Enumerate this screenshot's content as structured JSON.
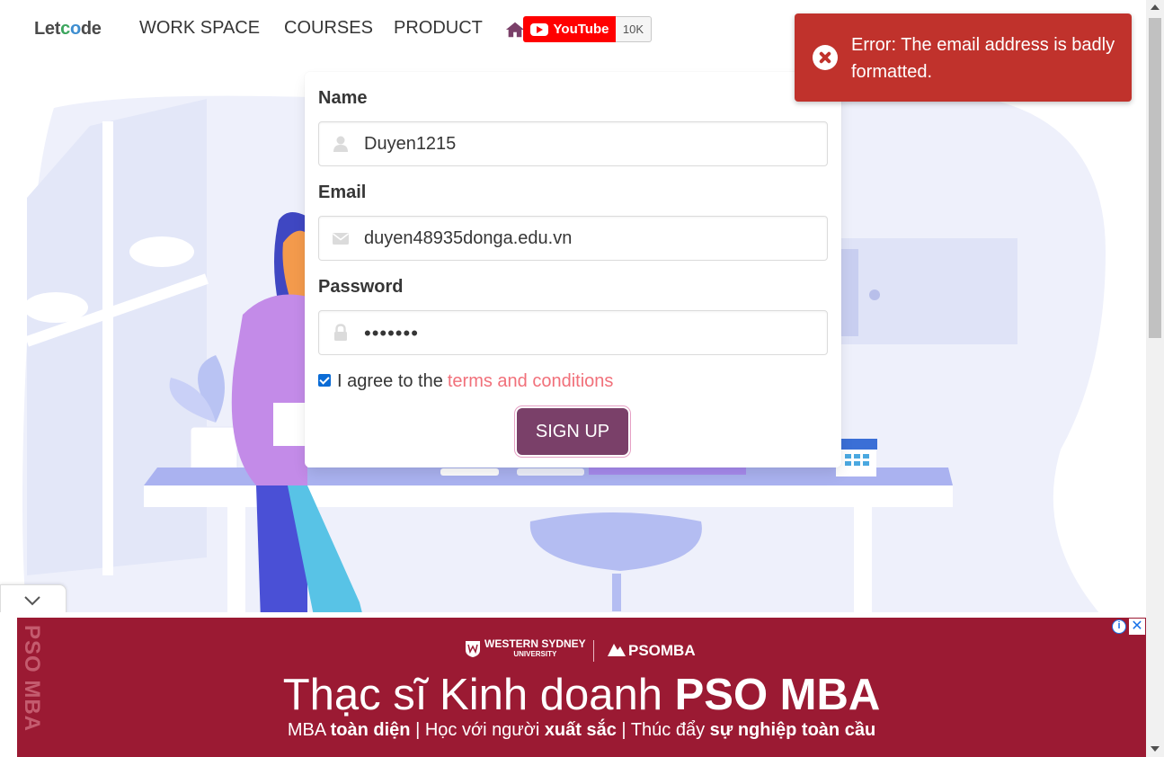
{
  "nav": {
    "logo_prefix": "Let",
    "logo_o1": "c",
    "logo_o2": "o",
    "logo_suffix": "de",
    "links": [
      "WORK SPACE",
      "COURSES",
      "PRODUCT"
    ],
    "youtube_label": "YouTube",
    "youtube_count": "10K"
  },
  "form": {
    "name_label": "Name",
    "name_value": "Duyen1215",
    "email_label": "Email",
    "email_value": "duyen48935donga.edu.vn",
    "password_label": "Password",
    "password_masked": "•••••••",
    "agree_text": "I agree to the",
    "terms_link": "terms and conditions",
    "agree_checked": true,
    "signup_label": "SIGN UP"
  },
  "toast": {
    "message": "Error: The email address is badly formatted."
  },
  "ad": {
    "vertical_text": "PSO MBA",
    "wsu_line1": "WESTERN SYDNEY",
    "wsu_line2": "UNIVERSITY",
    "pso_brand": "PSOMBA",
    "headline_plain": "Thạc sĩ Kinh doanh ",
    "headline_bold": "PSO MBA",
    "tag_1": "MBA ",
    "tag_2": "toàn diện",
    "tag_3": " | Học với người ",
    "tag_4": "xuất sắc",
    "tag_5": " | Thúc đẩy ",
    "tag_6": "sự nghiệp toàn cầu",
    "info_glyph": "i",
    "close_glyph": "✕"
  },
  "colors": {
    "toast_bg": "#c0322c",
    "signup_bg": "#7a4069",
    "terms_link": "#f1707a",
    "ad_bg": "#9b1a33",
    "illustration": "#eef0fb"
  }
}
